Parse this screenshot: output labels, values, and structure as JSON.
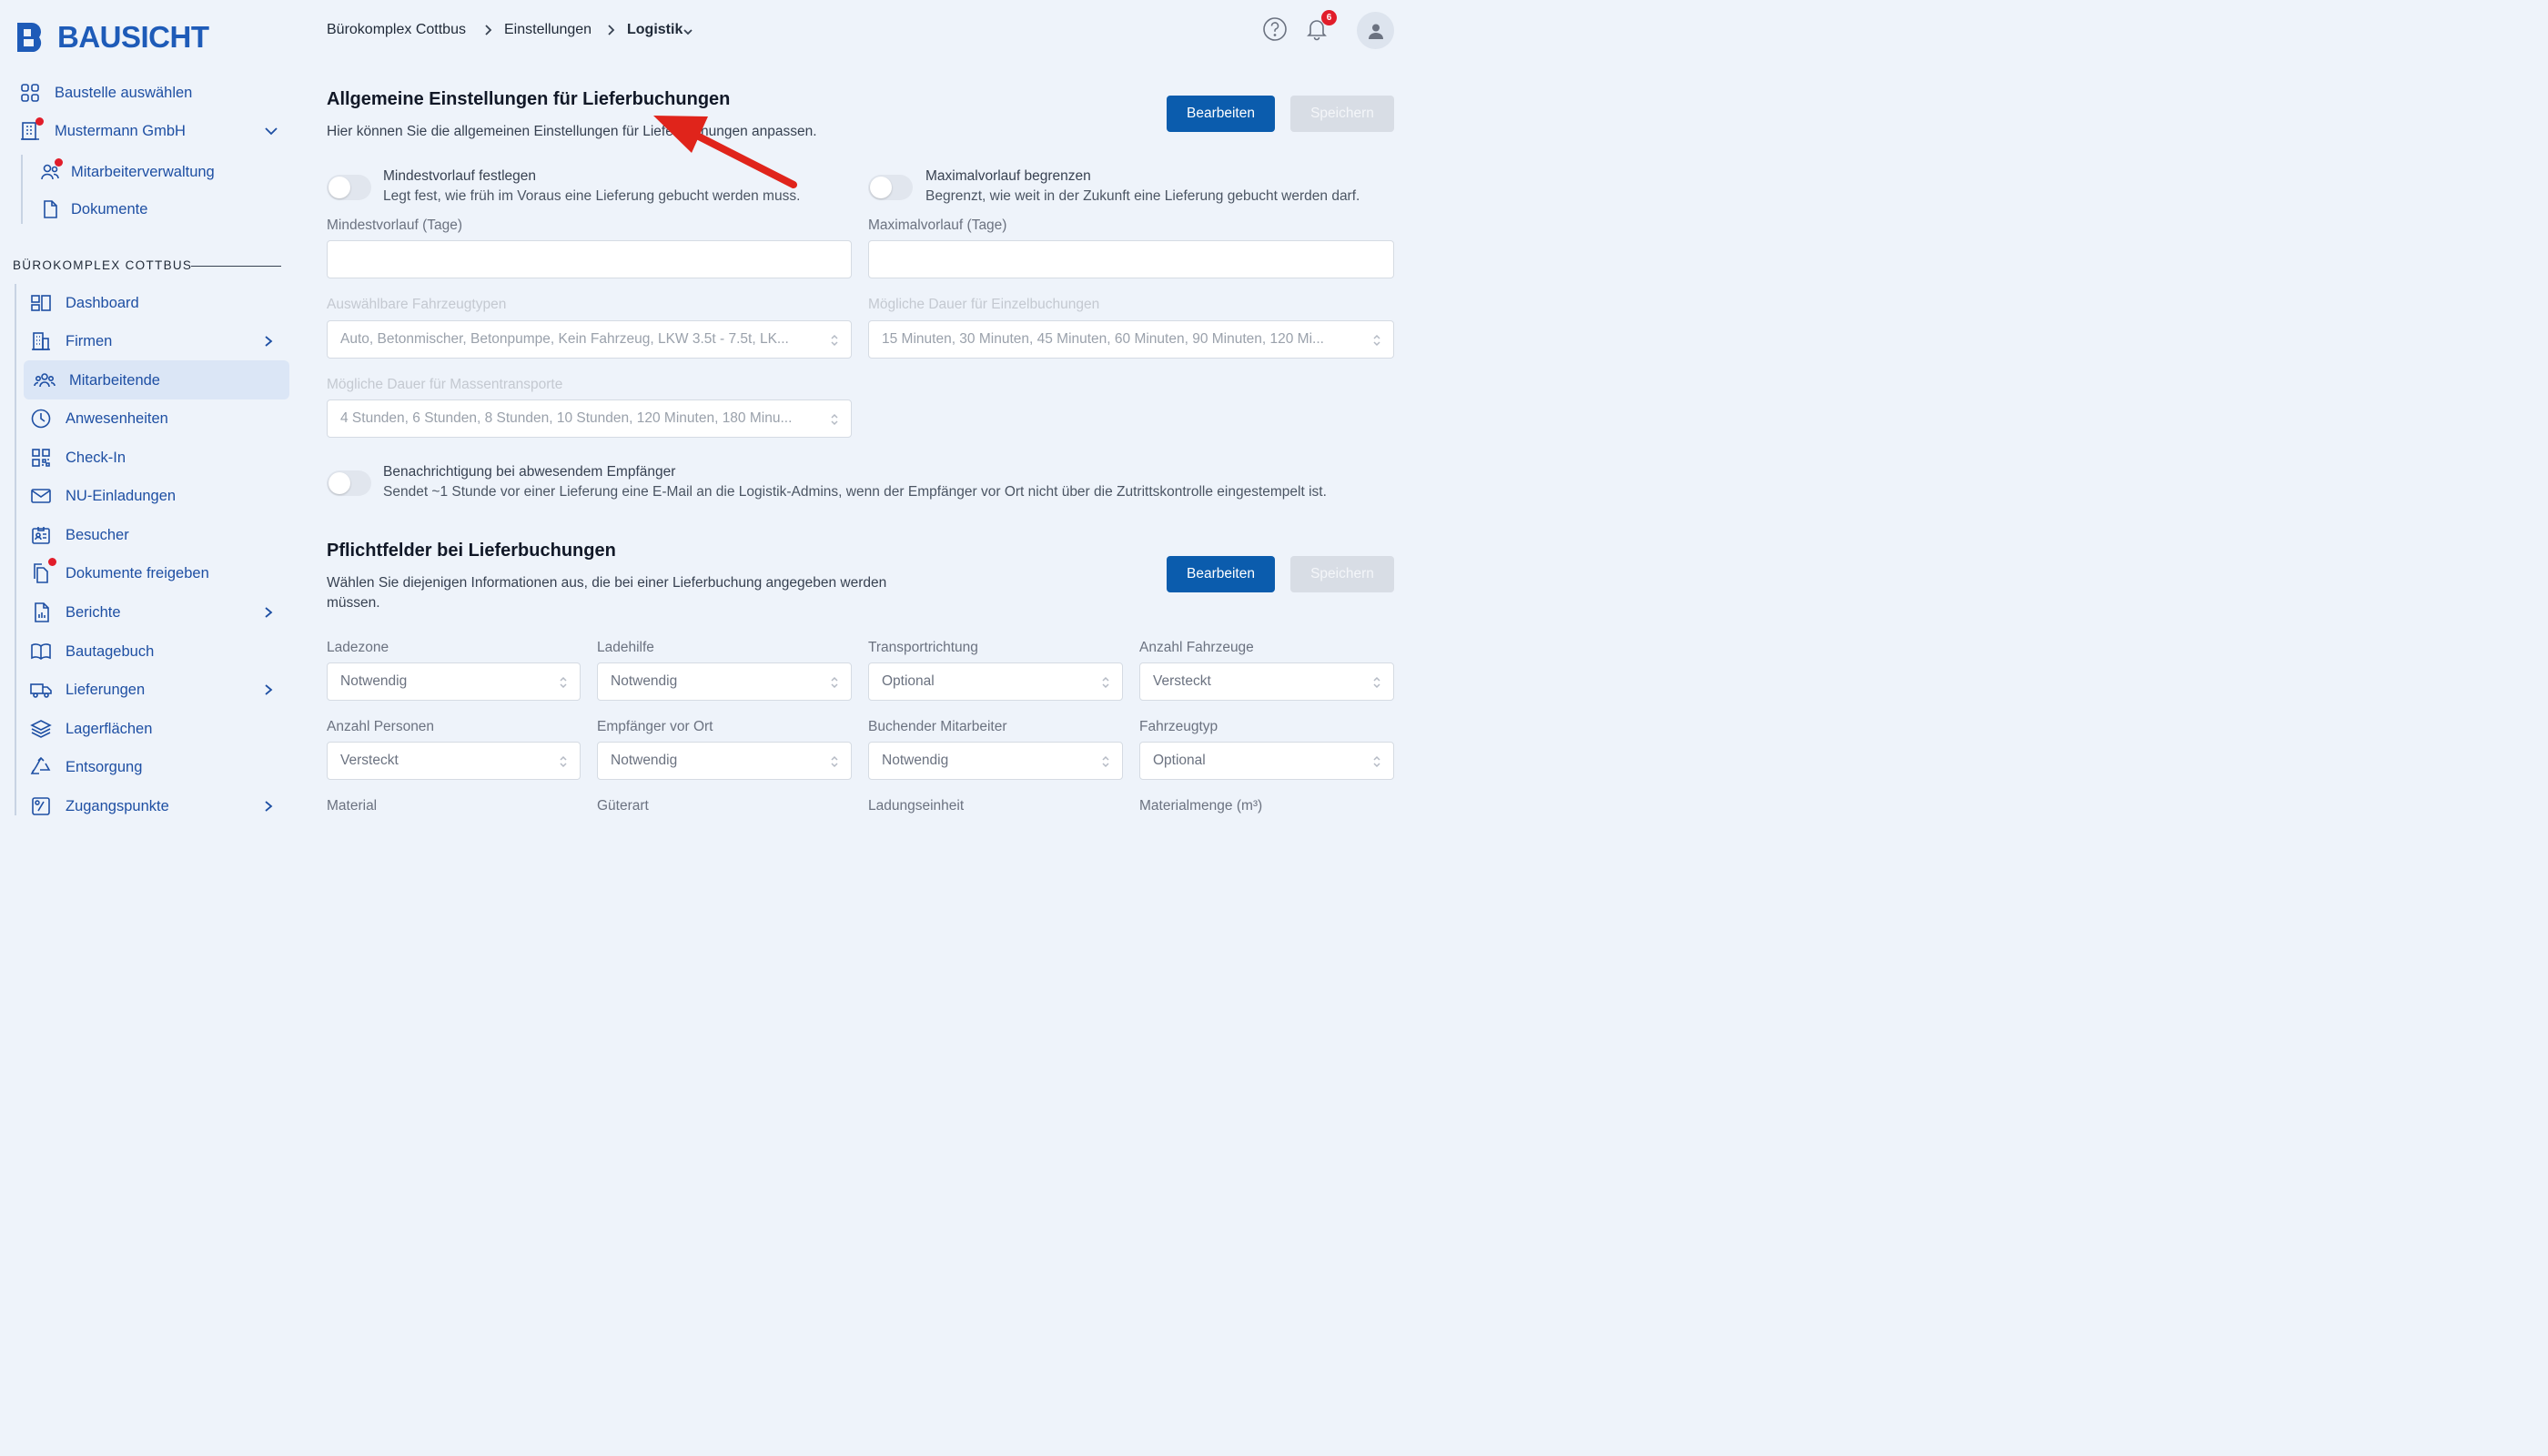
{
  "brand": {
    "name": "BAUSICHT"
  },
  "sidebar": {
    "select_site": "Baustelle auswählen",
    "company": "Mustermann GmbH",
    "company_items": [
      "Mitarbeiterverwaltung",
      "Dokumente"
    ],
    "section_title": "BÜROKOMPLEX COTTBUS",
    "items": [
      {
        "label": "Dashboard",
        "icon": "dashboard-icon"
      },
      {
        "label": "Firmen",
        "icon": "building-icon"
      },
      {
        "label": "Mitarbeitende",
        "icon": "users-icon",
        "active": true
      },
      {
        "label": "Anwesenheiten",
        "icon": "clock-icon"
      },
      {
        "label": "Check-In",
        "icon": "qr-code-icon"
      },
      {
        "label": "NU-Einladungen",
        "icon": "mail-icon"
      },
      {
        "label": "Besucher",
        "icon": "visitor-badge-icon"
      },
      {
        "label": "Dokumente freigeben",
        "icon": "documents-icon"
      },
      {
        "label": "Berichte",
        "icon": "report-icon"
      },
      {
        "label": "Bautagebuch",
        "icon": "book-icon"
      },
      {
        "label": "Lieferungen",
        "icon": "truck-icon"
      },
      {
        "label": "Lagerflächen",
        "icon": "layers-icon"
      },
      {
        "label": "Entsorgung",
        "icon": "recycle-icon"
      },
      {
        "label": "Zugangspunkte",
        "icon": "access-point-icon"
      }
    ]
  },
  "header": {
    "breadcrumbs": [
      "Bürokomplex Cottbus",
      "Einstellungen",
      "Logistik"
    ],
    "notification_count": "6"
  },
  "general": {
    "title": "Allgemeine Einstellungen für Lieferbuchungen",
    "description": "Hier können Sie die allgemeinen Einstellungen für Lieferbuchungen anpassen.",
    "edit_label": "Bearbeiten",
    "save_label": "Speichern",
    "min_toggle_title": "Mindestvorlauf festlegen",
    "min_toggle_sub": "Legt fest, wie früh im Voraus eine Lieferung gebucht werden muss.",
    "max_toggle_title": "Maximalvorlauf begrenzen",
    "max_toggle_sub": "Begrenzt, wie weit in der Zukunft eine Lieferung gebucht werden darf.",
    "min_label": "Mindestvorlauf (Tage)",
    "max_label": "Maximalvorlauf (Tage)",
    "vehicle_label": "Auswählbare Fahrzeugtypen",
    "vehicle_value": "Auto, Betonmischer, Betonpumpe, Kein Fahrzeug, LKW 3.5t - 7.5t, LK...",
    "duration_label": "Mögliche Dauer für Einzelbuchungen",
    "duration_value": "15 Minuten, 30 Minuten, 45 Minuten, 60 Minuten, 90 Minuten, 120 Mi...",
    "mass_label": "Mögliche Dauer für Massentransporte",
    "mass_value": "4 Stunden, 6 Stunden, 8 Stunden, 10 Stunden, 120 Minuten, 180 Minu...",
    "notify_title": "Benachrichtigung bei abwesendem Empfänger",
    "notify_sub": "Sendet ~1 Stunde vor einer Lieferung eine E-Mail an die Logistik-Admins, wenn der Empfänger vor Ort nicht über die Zutrittskontrolle eingestempelt ist."
  },
  "required": {
    "title": "Pflichtfelder bei Lieferbuchungen",
    "description_line1": "Wählen Sie diejenigen Informationen aus, die bei einer Lieferbuchung angegeben werden",
    "description_line2": "müssen.",
    "edit_label": "Bearbeiten",
    "save_label": "Speichern",
    "fields": [
      {
        "label": "Ladezone",
        "value": "Notwendig"
      },
      {
        "label": "Ladehilfe",
        "value": "Notwendig"
      },
      {
        "label": "Transportrichtung",
        "value": "Optional"
      },
      {
        "label": "Anzahl Fahrzeuge",
        "value": "Versteckt"
      },
      {
        "label": "Anzahl Personen",
        "value": "Versteckt"
      },
      {
        "label": "Empfänger vor Ort",
        "value": "Notwendig"
      },
      {
        "label": "Buchender Mitarbeiter",
        "value": "Notwendig"
      },
      {
        "label": "Fahrzeugtyp",
        "value": "Optional"
      },
      {
        "label": "Material",
        "value": ""
      },
      {
        "label": "Güterart",
        "value": ""
      },
      {
        "label": "Ladungseinheit",
        "value": ""
      },
      {
        "label": "Materialmenge (m³)",
        "value": ""
      }
    ]
  },
  "colors": {
    "accent": "#0b5cad",
    "brand": "#1e5bb8",
    "alert": "#e11d2a",
    "annotation_arrow": "#e0241b"
  }
}
